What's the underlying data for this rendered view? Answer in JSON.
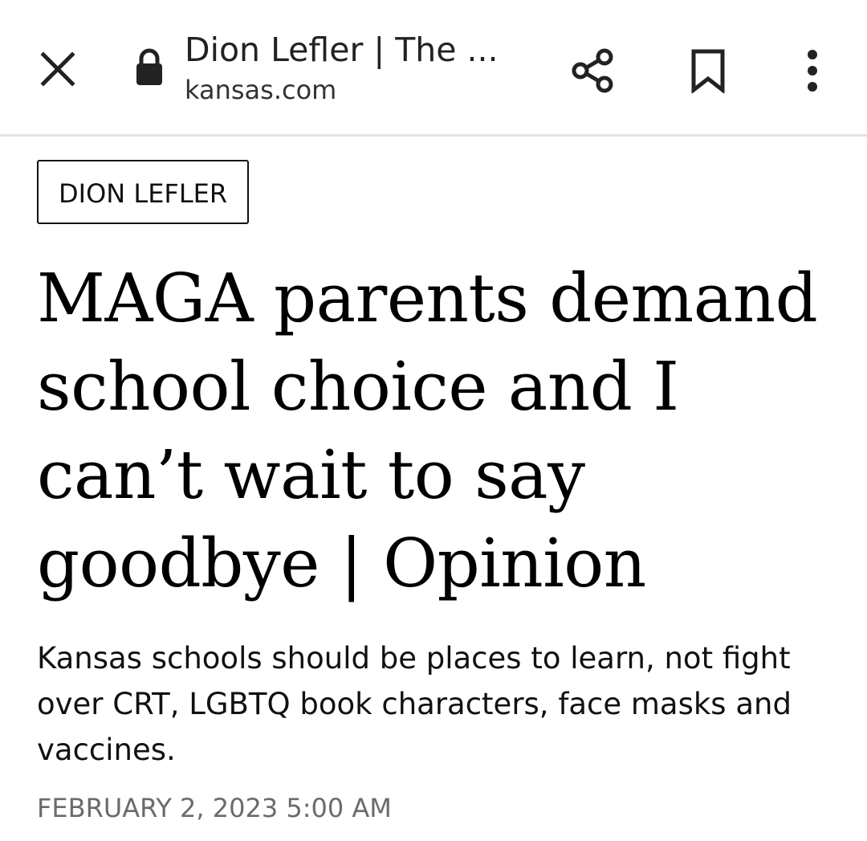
{
  "toolbar": {
    "page_title": "Dion Lefler | The ...",
    "domain": "kansas.com",
    "icons": {
      "close": "close-icon",
      "lock": "lock-icon",
      "share": "share-icon",
      "bookmark": "bookmark-icon",
      "menu": "more-vert-icon"
    }
  },
  "article": {
    "author_tag": "DION LEFLER",
    "headline": "MAGA parents demand school choice and I can’t wait to say goodbye | Opinion",
    "summary": "Kansas schools should be places to learn, not fight over CRT, LGBTQ book characters, face masks and vaccines.",
    "dateline": "FEBRUARY 2, 2023 5:00 AM"
  },
  "colors": {
    "text": "#111111",
    "muted": "#6b6b6b",
    "divider": "#e3e3e3",
    "background": "#ffffff"
  }
}
